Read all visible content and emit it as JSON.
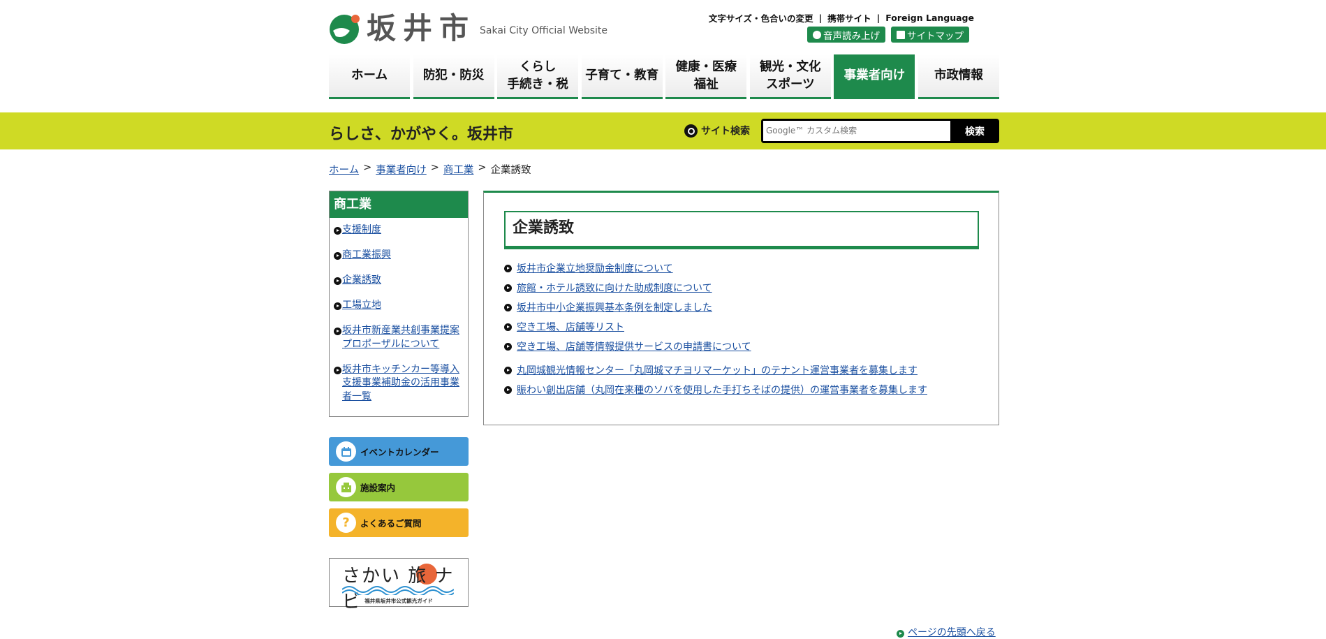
{
  "header": {
    "logo_text": "坂井市",
    "logo_sub": "Sakai City Official Website",
    "util_links": [
      "文字サイズ・色合いの変更",
      "携帯サイト",
      "Foreign Language"
    ],
    "util_sep": "|",
    "voice_button": "音声読み上げ",
    "sitemap_button": "サイトマップ",
    "nav": [
      {
        "label": "ホーム"
      },
      {
        "label": "防犯・防災"
      },
      {
        "label": "くらし\n手続き・税"
      },
      {
        "label": "子育て・教育"
      },
      {
        "label": "健康・医療\n福祉"
      },
      {
        "label": "観光・文化\nスポーツ"
      },
      {
        "label": "事業者向け"
      },
      {
        "label": "市政情報"
      }
    ]
  },
  "band": {
    "slogan": "らしさ、かがやく。坂井市",
    "search_label": "サイト検索",
    "search_placeholder": "Google™ カスタム検索",
    "search_button": "検索"
  },
  "breadcrumb": {
    "items": [
      "ホーム",
      "事業者向け",
      "商工業"
    ],
    "current": "企業誘致",
    "sep": ">"
  },
  "sidebar": {
    "title": "商工業",
    "items": [
      "支援制度",
      "商工業振興",
      "企業誘致",
      "工場立地",
      "坂井市新産業共創事業提案プロポーザルについて",
      "坂井市キッチンカー等導入支援事業補助金の活用事業者一覧"
    ],
    "buttons": {
      "calendar": "イベントカレンダー",
      "facilities": "施設案内",
      "faq": "よくあるご質問"
    },
    "banner": {
      "title": "さかい 旅 ナビ",
      "sub": "福井県坂井市公式観光ガイド"
    }
  },
  "main": {
    "title": "企業誘致",
    "links": [
      "坂井市企業立地奨励金制度について",
      "旅館・ホテル誘致に向けた助成制度について",
      "坂井市中小企業振興基本条例を制定しました",
      "空き工場、店舗等リスト",
      "空き工場、店舗等情報提供サービスの申請書について",
      "丸岡城観光情報センター「丸岡城マチヨリマーケット」のテナント運営事業者を募集します",
      "賑わい創出店舗（丸岡在来種のソバを使用した手打ちそばの提供）の運営事業者を募集します"
    ]
  },
  "footer": {
    "pagetop": "ページの先頭へ戻る"
  },
  "colors": {
    "accent_green": "#1e8a4c",
    "band_yellow": "#cfda25",
    "calendar_blue": "#4599d8",
    "facility_green": "#96c83c",
    "faq_orange": "#f4b32a"
  },
  "icons": [
    "logo-mark",
    "speaker-icon",
    "sitemap-icon",
    "search-icon",
    "calendar-icon",
    "building-icon",
    "question-icon",
    "arrow-bullet-icon"
  ]
}
